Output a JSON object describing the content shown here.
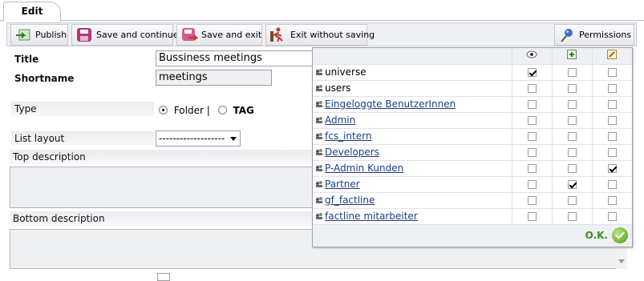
{
  "tabs": [
    {
      "label": "Edit"
    }
  ],
  "toolbar": {
    "publish": "Publish",
    "save_continue": "Save and continue",
    "save_exit": "Save and exit",
    "exit_nosave": "Exit without saving",
    "permissions": "Permissions"
  },
  "form": {
    "title_label": "Title",
    "title_value": "Bussiness meetings",
    "shortname_label": "Shortname",
    "shortname_value": "meetings",
    "type_label": "Type",
    "type_option_folder": "Folder |",
    "type_option_tag": "TAG",
    "type_selected": "Folder",
    "list_layout_label": "List layout",
    "list_layout_value": "-------------------",
    "top_description_label": "Top description",
    "bottom_description_label": "Bottom description"
  },
  "permissions": {
    "columns": [
      "view-icon",
      "add-icon",
      "edit-icon"
    ],
    "rows": [
      {
        "name": "universe",
        "link": false,
        "perms": [
          true,
          false,
          false
        ]
      },
      {
        "name": "users",
        "link": false,
        "perms": [
          false,
          false,
          false
        ]
      },
      {
        "name": "Eingeloggte BenutzerInnen",
        "link": true,
        "perms": [
          false,
          false,
          false
        ]
      },
      {
        "name": "Admin",
        "link": true,
        "perms": [
          false,
          false,
          false
        ]
      },
      {
        "name": "fcs_intern",
        "link": true,
        "perms": [
          false,
          false,
          false
        ]
      },
      {
        "name": "Developers",
        "link": true,
        "perms": [
          false,
          false,
          false
        ]
      },
      {
        "name": "P-Admin Kunden",
        "link": true,
        "perms": [
          false,
          false,
          true
        ]
      },
      {
        "name": "Partner",
        "link": true,
        "perms": [
          false,
          true,
          false
        ]
      },
      {
        "name": "gf_factline",
        "link": true,
        "perms": [
          false,
          false,
          false
        ]
      },
      {
        "name": "factline mitarbeiter",
        "link": true,
        "perms": [
          false,
          false,
          false
        ]
      }
    ],
    "ok_label": "O.K."
  },
  "colors": {
    "accent_link": "#1b3c8a",
    "ok_green": "#3a8f1d"
  }
}
